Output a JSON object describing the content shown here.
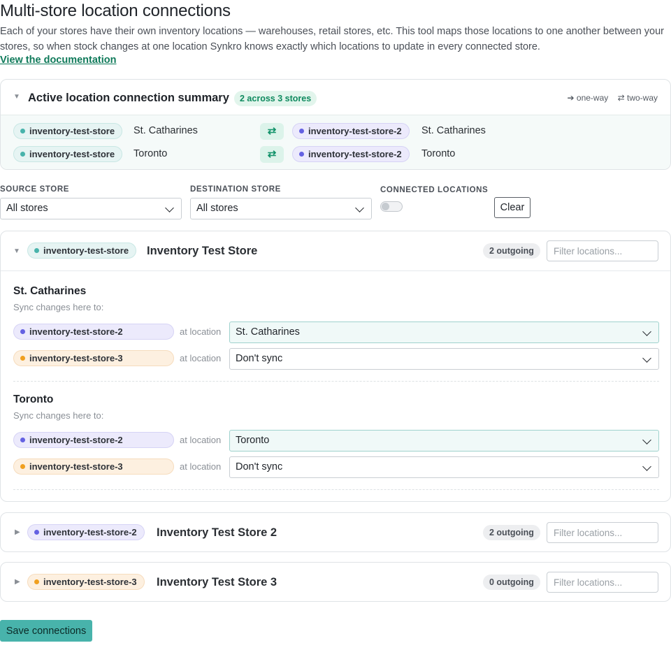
{
  "page": {
    "title": "Multi-store location connections",
    "intro": "Each of your stores have their own inventory locations — warehouses, retail stores, etc. This tool maps those locations to one another between your stores, so when stock changes at one location Synkro knows exactly which locations to update in every connected store.",
    "doc_link": "View the documentation"
  },
  "summary": {
    "title": "Active location connection summary",
    "count": "2 across 3 stores",
    "legend_one_way": "➔ one-way",
    "legend_two_way": "⇄ two-way",
    "connections": [
      {
        "source_store": "inventory-test-store",
        "source_location": "St. Catharines",
        "direction": "⇄",
        "dest_store": "inventory-test-store-2",
        "dest_location": "St. Catharines"
      },
      {
        "source_store": "inventory-test-store",
        "source_location": "Toronto",
        "direction": "⇄",
        "dest_store": "inventory-test-store-2",
        "dest_location": "Toronto"
      }
    ]
  },
  "filters": {
    "source_label": "SOURCE STORE",
    "source_value": "All stores",
    "destination_label": "DESTINATION STORE",
    "destination_value": "All stores",
    "connected_label": "CONNECTED LOCATIONS",
    "connected_on": false,
    "clear_label": "Clear"
  },
  "stores": [
    {
      "handle": "inventory-test-store",
      "name": "Inventory Test Store",
      "outgoing": "2 outgoing",
      "filter_placeholder": "Filter locations...",
      "expanded": true,
      "locations": [
        {
          "name": "St. Catharines",
          "sub": "Sync changes here to:",
          "targets": [
            {
              "store": "inventory-test-store-2",
              "at": "at location",
              "value": "St. Catharines"
            },
            {
              "store": "inventory-test-store-3",
              "at": "at location",
              "value": "Don't sync"
            }
          ]
        },
        {
          "name": "Toronto",
          "sub": "Sync changes here to:",
          "targets": [
            {
              "store": "inventory-test-store-2",
              "at": "at location",
              "value": "Toronto"
            },
            {
              "store": "inventory-test-store-3",
              "at": "at location",
              "value": "Don't sync"
            }
          ]
        }
      ]
    },
    {
      "handle": "inventory-test-store-2",
      "name": "Inventory Test Store 2",
      "outgoing": "2 outgoing",
      "filter_placeholder": "Filter locations...",
      "expanded": false
    },
    {
      "handle": "inventory-test-store-3",
      "name": "Inventory Test Store 3",
      "outgoing": "0 outgoing",
      "filter_placeholder": "Filter locations...",
      "expanded": false
    }
  ],
  "save_label": "Save connections",
  "colors": {
    "accent": "#48b3ab",
    "store1": "#48b3ab",
    "store2": "#6461e2",
    "store3": "#f0a020",
    "link_green": "#0f7a5a"
  }
}
